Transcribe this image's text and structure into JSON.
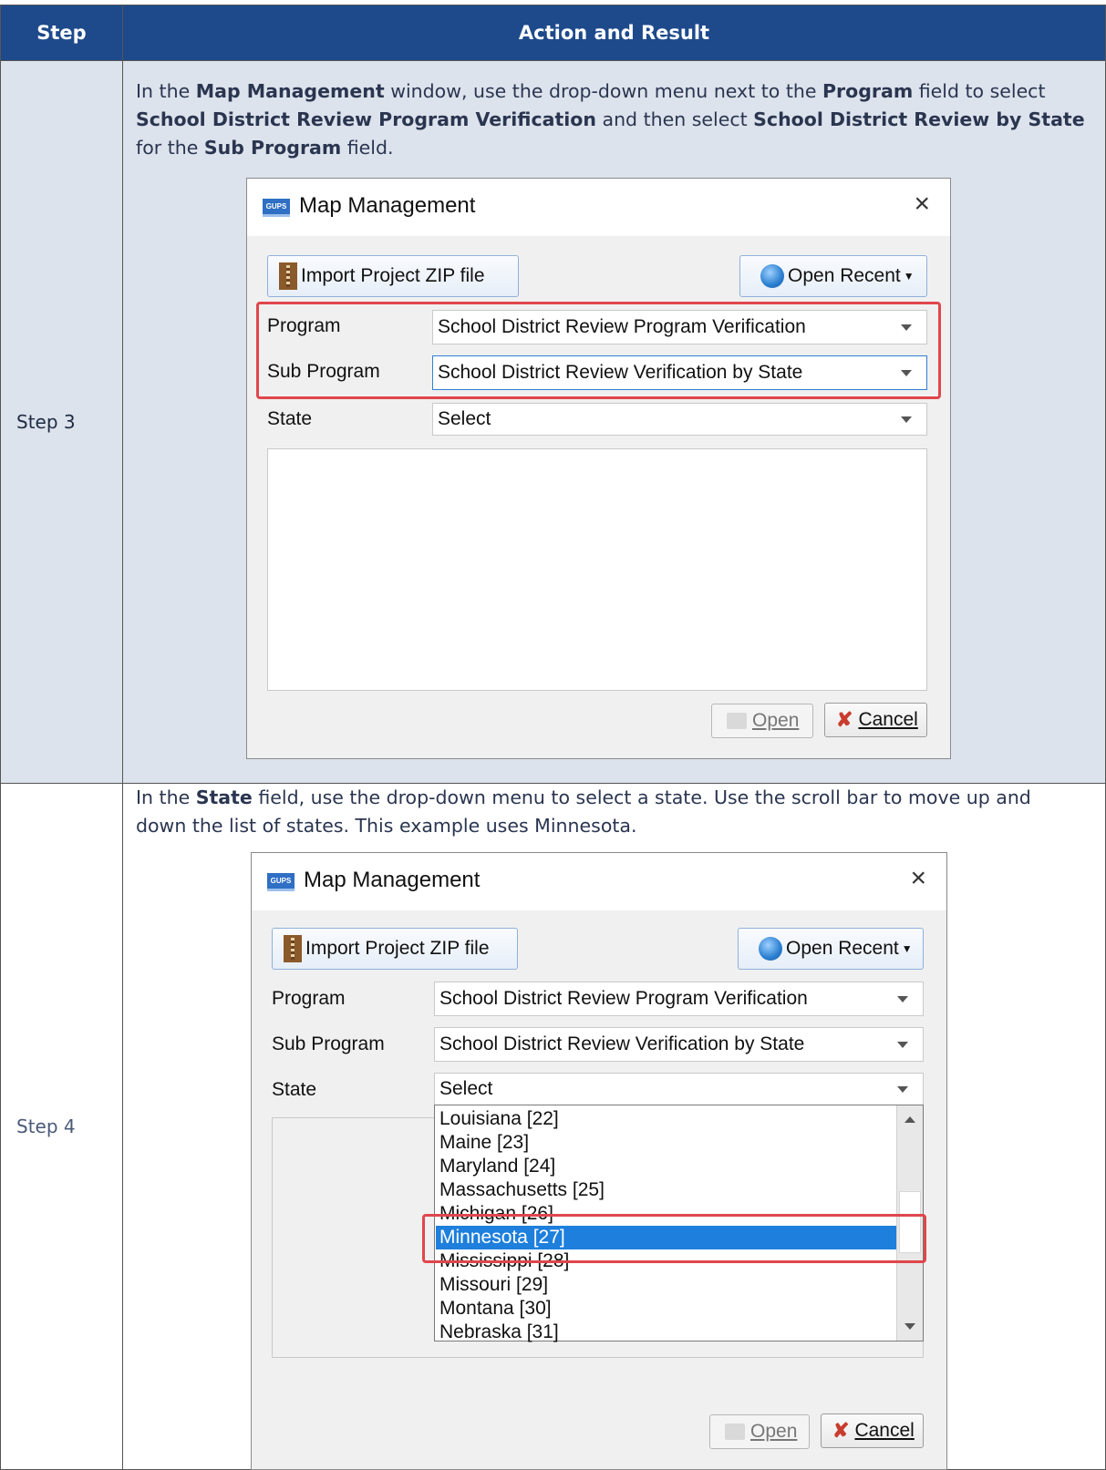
{
  "table": {
    "header_step": "Step",
    "header_action": "Action and Result"
  },
  "step3": {
    "label": "Step 3",
    "instr": {
      "p1": "In the ",
      "b1": "Map Management",
      "p2": " window, use the drop-down menu next to the ",
      "b2": "Program",
      "p3": " field to select ",
      "b3": "School District Review Program Verification",
      "p4": " and then select ",
      "b4": "School District Review by State",
      "p5": " for the ",
      "b5": "Sub Program",
      "p6": " field."
    },
    "dialog": {
      "logo": "GUPS",
      "title": "Map Management",
      "import_label": "Import Project ZIP file",
      "open_recent_label": "Open Recent",
      "program_label": "Program",
      "program_value": "School District Review Program Verification",
      "subprogram_label": "Sub Program",
      "subprogram_value": "School District Review Verification by State",
      "state_label": "State",
      "state_value": "Select",
      "open_label": "Open",
      "cancel_label": "Cancel"
    }
  },
  "step4": {
    "label": "Step 4",
    "instr": "In the State field, use the drop-down menu to select a state. Use the scroll bar to move up and down the list of states. This example uses Minnesota.",
    "instr_bold": "State",
    "instr_pre": "In the ",
    "instr_post": " field, use the drop-down menu to select a state. Use the scroll bar to move up and down the list of states. This example uses Minnesota.",
    "dialog": {
      "logo": "GUPS",
      "title": "Map Management",
      "import_label": "Import Project ZIP file",
      "open_recent_label": "Open Recent",
      "program_label": "Program",
      "program_value": "School District Review Program Verification",
      "subprogram_label": "Sub Program",
      "subprogram_value": "School District Review Verification by State",
      "state_label": "State",
      "state_value": "Select",
      "open_label": "Open",
      "cancel_label": "Cancel",
      "states": [
        "Louisiana [22]",
        "Maine [23]",
        "Maryland [24]",
        "Massachusetts [25]",
        "Michigan [26]",
        "Minnesota [27]",
        "Mississippi [28]",
        "Missouri [29]",
        "Montana [30]",
        "Nebraska [31]"
      ],
      "selected_state": "Minnesota [27]"
    }
  }
}
